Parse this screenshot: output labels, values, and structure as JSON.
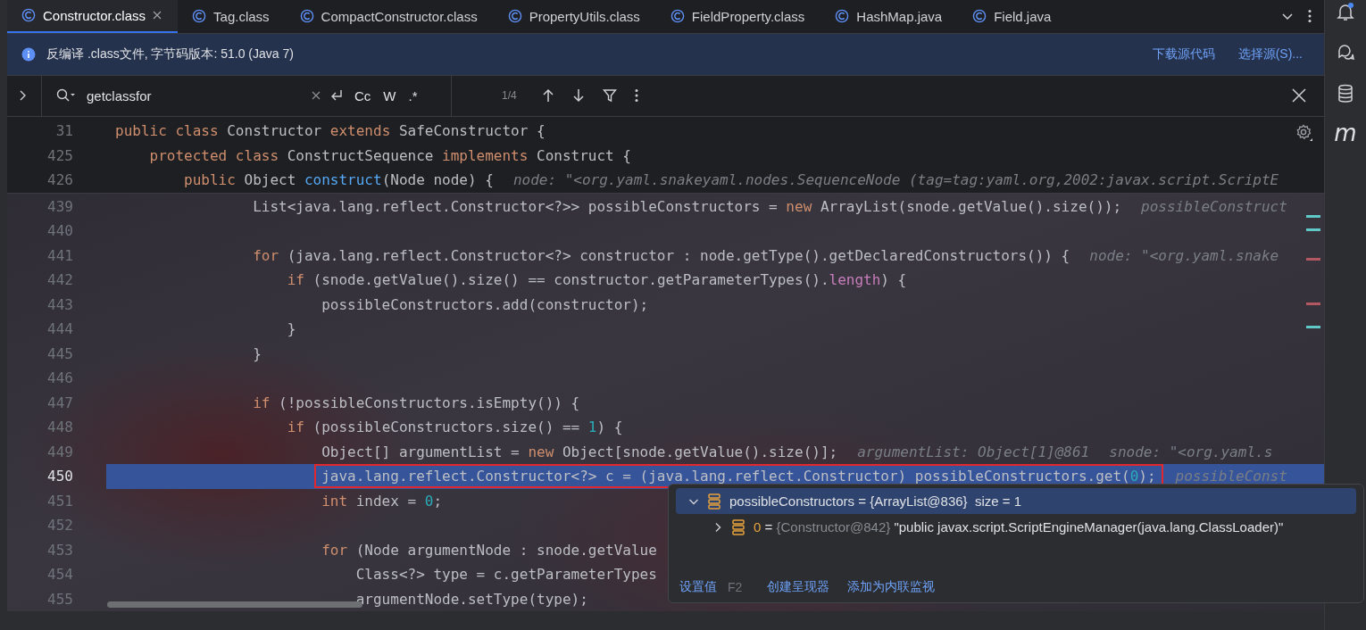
{
  "tabs": [
    {
      "label": "Constructor.class",
      "selected": true,
      "closable": true
    },
    {
      "label": "Tag.class",
      "selected": false,
      "closable": false
    },
    {
      "label": "CompactConstructor.class",
      "selected": false,
      "closable": false
    },
    {
      "label": "PropertyUtils.class",
      "selected": false,
      "closable": false
    },
    {
      "label": "FieldProperty.class",
      "selected": false,
      "closable": false
    },
    {
      "label": "HashMap.java",
      "selected": false,
      "closable": false
    },
    {
      "label": "Field.java",
      "selected": false,
      "closable": false
    }
  ],
  "banner": {
    "message": "反编译 .class文件, 字节码版本: 51.0 (Java 7)",
    "links": [
      "下载源代码",
      "选择源(S)..."
    ]
  },
  "search": {
    "value": "getclassfor",
    "toggles": [
      "Cc",
      "W",
      ".*"
    ],
    "count": "1/4"
  },
  "toolbar": {
    "plugin_label": "m"
  },
  "sticky_lines": [
    {
      "num": "31",
      "code": [
        {
          "t": "public class ",
          "kind": "keyword"
        },
        {
          "t": "Constructor ",
          "kind": "plain"
        },
        {
          "t": "extends ",
          "kind": "keyword"
        },
        {
          "t": "SafeConstructor {",
          "kind": "plain"
        }
      ]
    },
    {
      "num": "425",
      "code": [
        {
          "t": "    protected class ",
          "kind": "keyword"
        },
        {
          "t": "ConstructSequence ",
          "kind": "plain"
        },
        {
          "t": "implements ",
          "kind": "keyword"
        },
        {
          "t": "Construct {",
          "kind": "plain"
        }
      ]
    },
    {
      "num": "426",
      "code": [
        {
          "t": "        public ",
          "kind": "keyword"
        },
        {
          "t": "Object ",
          "kind": "plain"
        },
        {
          "t": "construct",
          "kind": "method"
        },
        {
          "t": "(Node node) {",
          "kind": "plain"
        }
      ],
      "hints": [
        "node: \"<org.yaml.snakeyaml.nodes.SequenceNode (tag=tag:yaml.org,2002:javax.script.ScriptE"
      ]
    }
  ],
  "lines": [
    {
      "num": "439",
      "selected": false,
      "outlined": false,
      "code": [
        {
          "t": "                List<java.lang.reflect.Constructor<?>> possibleConstructors = ",
          "kind": "plain"
        },
        {
          "t": "new ",
          "kind": "keyword"
        },
        {
          "t": "ArrayList(snode.getValue().size());",
          "kind": "plain"
        }
      ],
      "hints": [
        "possibleConstruct"
      ]
    },
    {
      "num": "440",
      "selected": false
    },
    {
      "num": "441",
      "selected": false,
      "outlined": false,
      "code": [
        {
          "t": "                for ",
          "kind": "keyword"
        },
        {
          "t": "(java.lang.reflect.Constructor<?> constructor : node.getType().getDeclaredConstructors()) {",
          "kind": "plain"
        }
      ],
      "hints": [
        "node: \"<org.yaml.snake"
      ]
    },
    {
      "num": "442",
      "selected": false,
      "outlined": false,
      "code": [
        {
          "t": "                    if ",
          "kind": "keyword"
        },
        {
          "t": "(snode.getValue().size() == constructor.getParameterTypes().",
          "kind": "plain"
        },
        {
          "t": "length",
          "kind": "field"
        },
        {
          "t": ") {",
          "kind": "plain"
        }
      ]
    },
    {
      "num": "443",
      "selected": false,
      "outlined": false,
      "code": [
        {
          "t": "                        possibleConstructors.add(constructor);",
          "kind": "plain"
        }
      ]
    },
    {
      "num": "444",
      "selected": false,
      "outlined": false,
      "code": [
        {
          "t": "                    }",
          "kind": "plain"
        }
      ]
    },
    {
      "num": "445",
      "selected": false,
      "outlined": false,
      "code": [
        {
          "t": "                }",
          "kind": "plain"
        }
      ]
    },
    {
      "num": "446",
      "selected": false
    },
    {
      "num": "447",
      "selected": false,
      "outlined": false,
      "code": [
        {
          "t": "                if ",
          "kind": "keyword"
        },
        {
          "t": "(!possibleConstructors.isEmpty()) {",
          "kind": "plain"
        }
      ]
    },
    {
      "num": "448",
      "selected": false,
      "outlined": false,
      "code": [
        {
          "t": "                    if ",
          "kind": "keyword"
        },
        {
          "t": "(possibleConstructors.size() == ",
          "kind": "plain"
        },
        {
          "t": "1",
          "kind": "number"
        },
        {
          "t": ") {",
          "kind": "plain"
        }
      ]
    },
    {
      "num": "449",
      "selected": false,
      "outlined": false,
      "code": [
        {
          "t": "                        Object[] argumentList = ",
          "kind": "plain"
        },
        {
          "t": "new ",
          "kind": "keyword"
        },
        {
          "t": "Object[snode.getValue().size()];",
          "kind": "plain"
        }
      ],
      "hints": [
        "argumentList: Object[1]@861",
        "snode: \"<org.yaml.s"
      ]
    },
    {
      "num": "450",
      "selected": true,
      "outlined": true,
      "code": [
        {
          "t": "                        java.lang.reflect.Constructor<?> c = (java.lang.reflect.Constructor) possibleConstructors.get(",
          "kind": "plain"
        },
        {
          "t": "0",
          "kind": "number"
        },
        {
          "t": ");",
          "kind": "plain"
        }
      ],
      "hints": [
        "possibleConst"
      ]
    },
    {
      "num": "451",
      "selected": false,
      "outlined": false,
      "code": [
        {
          "t": "                        int ",
          "kind": "keyword"
        },
        {
          "t": "index = ",
          "kind": "plain"
        },
        {
          "t": "0",
          "kind": "number"
        },
        {
          "t": ";",
          "kind": "plain"
        }
      ]
    },
    {
      "num": "452",
      "selected": false
    },
    {
      "num": "453",
      "selected": false,
      "outlined": false,
      "code": [
        {
          "t": "                        for ",
          "kind": "keyword"
        },
        {
          "t": "(Node argumentNode : snode.getValue",
          "kind": "plain"
        }
      ]
    },
    {
      "num": "454",
      "selected": false,
      "outlined": false,
      "code": [
        {
          "t": "                            Class<?> type = c.getParameterTypes",
          "kind": "plain"
        }
      ]
    },
    {
      "num": "455",
      "selected": false,
      "outlined": false,
      "code": [
        {
          "t": "                            argumentNode.setType(type);",
          "kind": "plain"
        }
      ]
    }
  ],
  "popup": {
    "tree": [
      {
        "expanded": true,
        "selected": true,
        "parts": [
          {
            "t": "possibleConstructors = {ArrayList@836}  size = 1",
            "kind": "plain"
          }
        ],
        "children": [
          {
            "expanded": false,
            "selected": false,
            "parts": [
              {
                "t": "0",
                "kind": "index"
              },
              {
                "t": " = ",
                "kind": "plain"
              },
              {
                "t": "{Constructor@842} ",
                "kind": "reference"
              },
              {
                "t": "\"public javax.script.ScriptEngineManager(java.lang.ClassLoader)\"",
                "kind": "plain"
              }
            ]
          }
        ]
      }
    ],
    "actions": [
      {
        "label": "设置值",
        "shortcut": "F2"
      },
      {
        "label": "创建呈现器"
      },
      {
        "label": "添加为内联监视"
      }
    ]
  }
}
